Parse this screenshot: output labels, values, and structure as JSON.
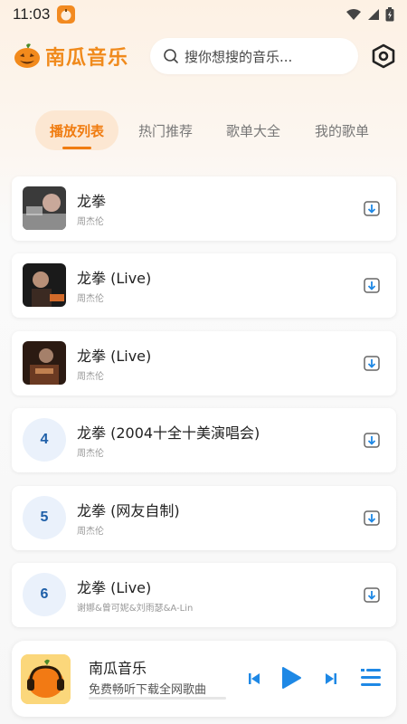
{
  "status": {
    "time": "11:03"
  },
  "app": {
    "name": "南瓜音乐"
  },
  "search": {
    "placeholder": "搜你想搜的音乐..."
  },
  "tabs": [
    {
      "label": "播放列表",
      "active": true
    },
    {
      "label": "热门推荐",
      "active": false
    },
    {
      "label": "歌单大全",
      "active": false
    },
    {
      "label": "我的歌单",
      "active": false
    }
  ],
  "songs": [
    {
      "title": "龙拳",
      "artist": "周杰伦",
      "cover": "album-cover"
    },
    {
      "title": "龙拳 (Live)",
      "artist": "周杰伦",
      "cover": "album-cover"
    },
    {
      "title": "龙拳 (Live)",
      "artist": "周杰伦",
      "cover": "album-cover"
    },
    {
      "title": "龙拳 (2004十全十美演唱会)",
      "artist": "周杰伦",
      "number": "4"
    },
    {
      "title": "龙拳 (网友自制)",
      "artist": "周杰伦",
      "number": "5"
    },
    {
      "title": "龙拳 (Live)",
      "artist": "谢娜&曾可妮&刘雨瑟&A-Lin",
      "number": "6"
    }
  ],
  "player": {
    "title": "南瓜音乐",
    "subtitle": "免费畅听下载全网歌曲",
    "progress": 0
  },
  "colors": {
    "accent": "#f07c10",
    "blue": "#1e88e5",
    "number": "#1e5fa8"
  }
}
